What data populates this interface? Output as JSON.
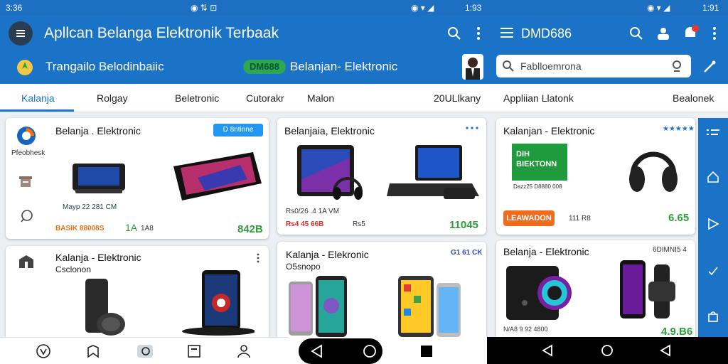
{
  "status": {
    "time_left": "3:36",
    "time_right": "1:43",
    "mid_text": "1:93",
    "right_text": "1:91"
  },
  "appbar": {
    "title": "Apllcan Belanga Elektronik Terbaak",
    "right_title": "DMD686"
  },
  "subbar": {
    "left_text": "Trangailo Belodinbaiic",
    "badge": "DM688",
    "mid_text": "Belanjan- Elektronic"
  },
  "search": {
    "placeholder": "Fablloemrona"
  },
  "tabs": [
    {
      "label": "Kalanja"
    },
    {
      "label": "Rolgay"
    },
    {
      "label": "Beletronic"
    },
    {
      "label": "Cutorakr"
    },
    {
      "label": "Malon"
    },
    {
      "label": "20ULlkany"
    },
    {
      "label": "Appliian Llatonk"
    },
    {
      "label": "Bealonek"
    }
  ],
  "cards": {
    "c1": {
      "side_label": "Pfeobhesk",
      "title": "Belanja . Elektronic",
      "chip": "D 8ntinne",
      "line1": "Mayp 22 281 CM",
      "line2": "BASIK 88008S",
      "line3": "1A",
      "line4": "1A8",
      "price": "842B"
    },
    "c2": {
      "title": "Belanjaia, Elektronic",
      "line1": "Rs0/26 .4 1A VM",
      "line2": "Rs4 45 66B",
      "line3": "Rs5",
      "price": "11045"
    },
    "c3": {
      "title": "Kalanjan - Elektronic",
      "stars": "★★★★★",
      "box_line1": "DIH",
      "box_line2": "BIEKTONN",
      "line1": "Dazz25 D8880 008",
      "chip": "LEAWADON",
      "line2": "111 R8",
      "price": "6.65"
    },
    "c4": {
      "title": "Kalanja - Elektronic",
      "sub": "Csclonon"
    },
    "c5": {
      "title": "Kalanja - Elekronic",
      "sub": "O5snopo",
      "chip": "G1 61 CK"
    },
    "c6": {
      "title": "Belanja - Elektronic",
      "chip": "6DIMNI5 4",
      "line1": "N/A8 9 92 4800",
      "price": "4.9.B6"
    }
  },
  "colors": {
    "primary": "#1a73c7",
    "price_green": "#2e9e3a",
    "accent_orange": "#ef6c1f"
  }
}
